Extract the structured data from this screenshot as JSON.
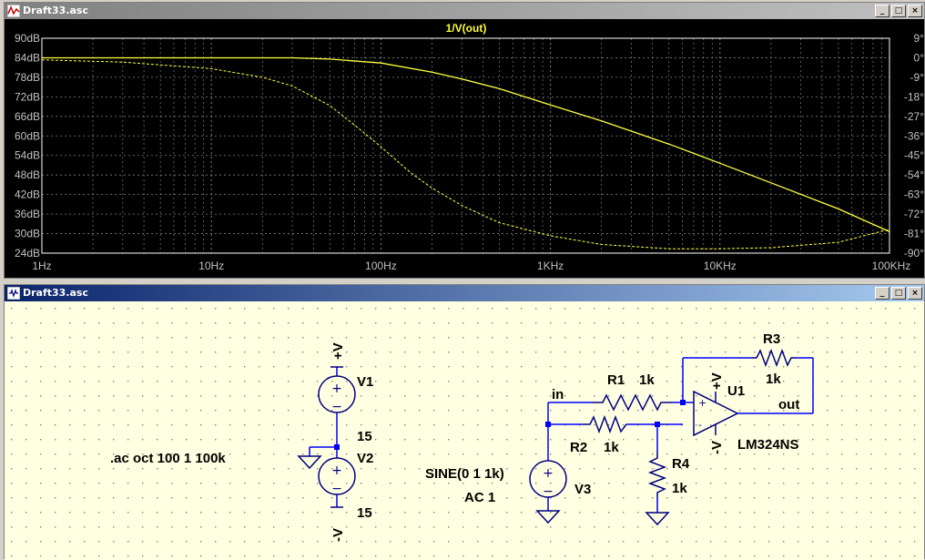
{
  "plot_window": {
    "title": "Draft33.asc",
    "trace_label": "1/V(out)",
    "buttons": [
      "_",
      "□",
      "×"
    ]
  },
  "schematic_window": {
    "title": "Draft33.asc",
    "buttons": [
      "_",
      "□",
      "×"
    ]
  },
  "chart_data": {
    "type": "line",
    "title": "1/V(out)",
    "x_scale": "log",
    "xlim": [
      1,
      100000
    ],
    "x_ticks": [
      "1Hz",
      "10Hz",
      "100Hz",
      "1KHz",
      "10KHz",
      "100KHz"
    ],
    "left_axis_ticks": [
      "90dB",
      "84dB",
      "78dB",
      "72dB",
      "66dB",
      "60dB",
      "54dB",
      "48dB",
      "42dB",
      "36dB",
      "30dB",
      "24dB"
    ],
    "right_axis_ticks": [
      "9°",
      "0°",
      "-9°",
      "-18°",
      "-27°",
      "-36°",
      "-45°",
      "-54°",
      "-63°",
      "-72°",
      "-81°",
      "-90°"
    ],
    "ylim_db": [
      24,
      90
    ],
    "ylim_phase": [
      -90,
      9
    ],
    "grid": true,
    "colors": {
      "background": "#000000",
      "trace": "#ffff40",
      "grid": "#808080",
      "axis_text": "#c0c0c0"
    },
    "series": [
      {
        "name": "1/V(out)",
        "axis": "magnitude",
        "style": "solid",
        "x": [
          1,
          10,
          30,
          50,
          100,
          200,
          300,
          500,
          1000,
          2000,
          5000,
          10000,
          20000,
          50000,
          100000
        ],
        "y": [
          84,
          84,
          84,
          83.6,
          82.4,
          79.6,
          77.5,
          74.5,
          69.5,
          64.6,
          57.5,
          51.6,
          45.6,
          37.6,
          30.6
        ]
      },
      {
        "name": "1/V(out)",
        "axis": "phase",
        "style": "dashed",
        "x": [
          1,
          3,
          10,
          20,
          30,
          50,
          70,
          100,
          150,
          200,
          300,
          500,
          1000,
          2000,
          5000,
          10000,
          20000,
          50000,
          100000
        ],
        "y": [
          -1,
          -2,
          -5,
          -9,
          -13,
          -22,
          -31,
          -41,
          -53,
          -60,
          -68,
          -76,
          -82,
          -86,
          -88,
          -88,
          -87.5,
          -85,
          -79
        ]
      }
    ]
  },
  "schematic": {
    "v1": {
      "name": "V1",
      "value": "15",
      "top_net": "+V"
    },
    "v2": {
      "name": "V2",
      "value": "15",
      "bottom_net": "-V"
    },
    "ac_directive": ".ac oct 100 1 100k",
    "v3": {
      "name": "V3",
      "value_line1": "SINE(0 1 1k)",
      "value_line2": "AC 1"
    },
    "r1": {
      "name": "R1",
      "value": "1k"
    },
    "r2": {
      "name": "R2",
      "value": "1k"
    },
    "r3": {
      "name": "R3",
      "value": "1k"
    },
    "r4": {
      "name": "R4",
      "value": "1k"
    },
    "u1": {
      "name": "U1",
      "model": "LM324NS",
      "plus_supply": "+V",
      "minus_supply": "-V",
      "plus_pin": "+",
      "minus_pin": "-"
    },
    "nets": {
      "in": "in",
      "out": "out"
    },
    "colors": {
      "wire": "#0000ff",
      "component": "#000080",
      "text": "#000000",
      "junction": "#0000ff",
      "background": "#ffffe1"
    }
  }
}
